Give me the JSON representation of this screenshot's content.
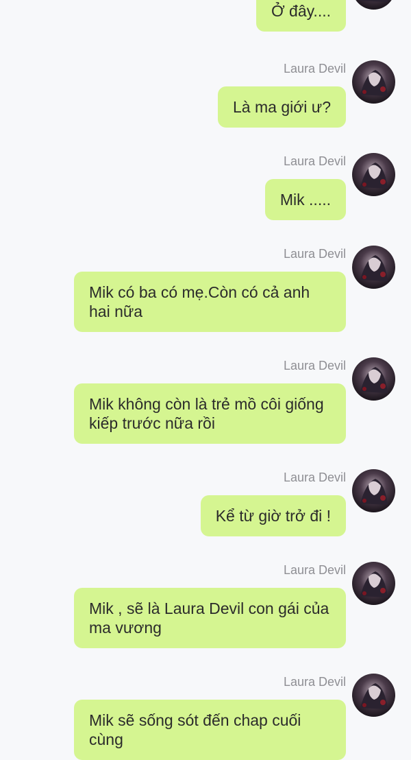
{
  "messages": [
    {
      "sender": "",
      "text": "Ở đây...."
    },
    {
      "sender": "Laura Devil",
      "text": "Là ma giới ư?"
    },
    {
      "sender": "Laura Devil",
      "text": "Mik ....."
    },
    {
      "sender": "Laura Devil",
      "text": "Mik có ba có mẹ.Còn có cả anh hai nữa"
    },
    {
      "sender": "Laura Devil",
      "text": "Mik không còn là trẻ mồ côi giống kiếp trước nữa rồi"
    },
    {
      "sender": "Laura Devil",
      "text": "Kể từ giờ trở đi !"
    },
    {
      "sender": "Laura Devil",
      "text": "Mik , sẽ là Laura Devil con gái của ma vương"
    },
    {
      "sender": "Laura Devil",
      "text": "Mik sẽ sống sót đến chap cuối cùng"
    }
  ],
  "colors": {
    "background": "#f7f8fa",
    "bubble": "#d5f591",
    "sender_name": "#8e8e93"
  }
}
